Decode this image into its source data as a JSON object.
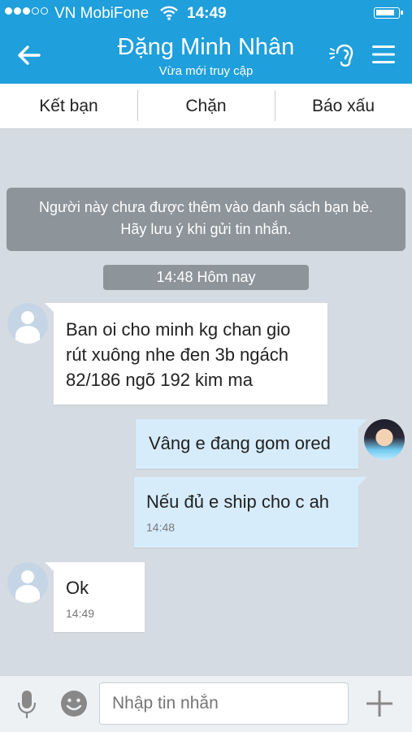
{
  "status_bar": {
    "carrier": "VN MobiFone",
    "time": "14:49",
    "signal_icon": "signal-dots-icon",
    "wifi_icon": "wifi-icon",
    "battery_icon": "battery-icon"
  },
  "header": {
    "title": "Đặng Minh Nhân",
    "subtitle": "Vừa mới truy cập",
    "back_icon": "back-arrow-icon",
    "sound_icon": "sound-ear-icon",
    "menu_icon": "hamburger-menu-icon",
    "background_color": "#1f9fdb"
  },
  "actions": {
    "add_friend": "Kết bạn",
    "block": "Chặn",
    "report": "Báo xấu"
  },
  "chat": {
    "notice": "Người này chưa được thêm vào danh sách bạn bè. Hãy lưu ý khi gửi tin nhắn.",
    "date_label": "14:48 Hôm nay",
    "messages": [
      {
        "direction": "incoming",
        "text": "Ban oi cho minh kg chan gio rút xuông nhe  đen 3b ngách 82/186 ngõ 192 kim ma",
        "time": ""
      },
      {
        "direction": "outgoing",
        "text": "Vâng e đang gom ored",
        "time": ""
      },
      {
        "direction": "outgoing",
        "text": "Nếu đủ e ship cho c ah",
        "time": "14:48"
      },
      {
        "direction": "incoming",
        "text": "Ok",
        "time": "14:49"
      }
    ]
  },
  "composer": {
    "placeholder": "Nhập tin nhắn",
    "mic_icon": "microphone-icon",
    "emoji_icon": "emoji-icon",
    "plus_icon": "plus-icon"
  },
  "colors": {
    "accent": "#1f9fdb",
    "outgoing_bubble": "#d6ecfb",
    "incoming_bubble": "#ffffff",
    "chat_background": "#d5dbe2",
    "system_chip": "#8d949a"
  }
}
